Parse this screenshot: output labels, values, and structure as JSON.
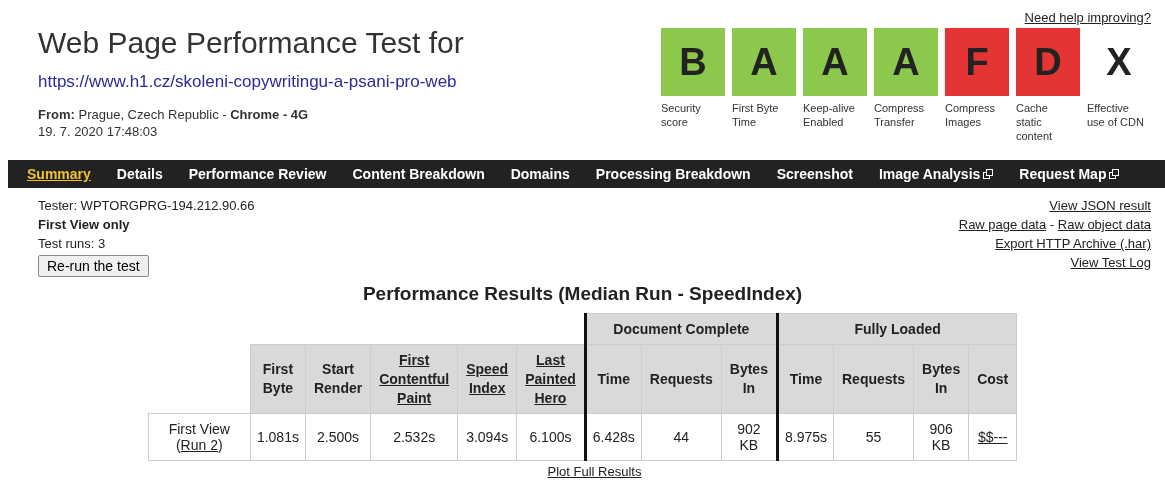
{
  "header": {
    "title": "Web Page Performance Test for",
    "url": "https://www.h1.cz/skoleni-copywritingu-a-psani-pro-web",
    "from_label": "From:",
    "from_location": "Prague, Czech Republic - ",
    "browser": "Chrome - 4G",
    "date": "19. 7. 2020 17:48:03"
  },
  "help_link": "Need help improving?",
  "grades": [
    {
      "grade": "B",
      "label": "Security score",
      "color": "#8cc84b"
    },
    {
      "grade": "A",
      "label": "First Byte Time",
      "color": "#8cc84b"
    },
    {
      "grade": "A",
      "label": "Keep-alive Enabled",
      "color": "#8cc84b"
    },
    {
      "grade": "A",
      "label": "Compress Transfer",
      "color": "#8cc84b"
    },
    {
      "grade": "F",
      "label": "Compress Images",
      "color": "#e53434"
    },
    {
      "grade": "D",
      "label": "Cache static content",
      "color": "#e53434"
    },
    {
      "grade": "X",
      "label": "Effective use of CDN",
      "color": "#ffffff"
    }
  ],
  "tabs": [
    {
      "label": "Summary",
      "selected": true,
      "external": false
    },
    {
      "label": "Details",
      "selected": false,
      "external": false
    },
    {
      "label": "Performance Review",
      "selected": false,
      "external": false
    },
    {
      "label": "Content Breakdown",
      "selected": false,
      "external": false
    },
    {
      "label": "Domains",
      "selected": false,
      "external": false
    },
    {
      "label": "Processing Breakdown",
      "selected": false,
      "external": false
    },
    {
      "label": "Screenshot",
      "selected": false,
      "external": false
    },
    {
      "label": "Image Analysis",
      "selected": false,
      "external": true
    },
    {
      "label": "Request Map",
      "selected": false,
      "external": true
    }
  ],
  "test_info": {
    "tester": "Tester: WPTORGPRG-194.212.90.66",
    "view": "First View only",
    "runs": "Test runs: 3",
    "rerun_button": "Re-run the test"
  },
  "links": [
    [
      "View JSON result"
    ],
    [
      "Raw page data",
      " - ",
      "Raw object data"
    ],
    [
      "Export HTTP Archive (.har)"
    ],
    [
      "View Test Log"
    ]
  ],
  "results": {
    "title": "Performance Results (Median Run - SpeedIndex)",
    "columns": [
      {
        "label": "First Byte",
        "link": false
      },
      {
        "label": "Start Render",
        "link": false
      },
      {
        "label": "First Contentful Paint",
        "link": true
      },
      {
        "label": "Speed Index",
        "link": true
      },
      {
        "label": "Last Painted Hero",
        "link": true
      }
    ],
    "groups": [
      {
        "label": "Document Complete",
        "columns": [
          {
            "label": "Time",
            "link": false
          },
          {
            "label": "Requests",
            "link": false
          },
          {
            "label": "Bytes In",
            "link": false
          }
        ]
      },
      {
        "label": "Fully Loaded",
        "columns": [
          {
            "label": "Time",
            "link": false
          },
          {
            "label": "Requests",
            "link": false
          },
          {
            "label": "Bytes In",
            "link": false
          },
          {
            "label": "Cost",
            "link": false
          }
        ]
      }
    ],
    "rows": [
      {
        "label": "First View",
        "run": [
          "(",
          "Run 2",
          ")"
        ],
        "cells": [
          {
            "text": "1.081s",
            "link": false
          },
          {
            "text": "2.500s",
            "link": false
          },
          {
            "text": "2.532s",
            "link": false
          },
          {
            "text": "3.094s",
            "link": false
          },
          {
            "text": "6.100s",
            "link": false
          },
          {
            "text": "6.428s",
            "link": false
          },
          {
            "text": "44",
            "link": false
          },
          {
            "text": "902 KB",
            "link": false
          },
          {
            "text": "8.975s",
            "link": false
          },
          {
            "text": "55",
            "link": false
          },
          {
            "text": "906 KB",
            "link": false
          },
          {
            "text": "$$---",
            "link": true
          }
        ]
      }
    ],
    "plot_link": "Plot Full Results"
  }
}
